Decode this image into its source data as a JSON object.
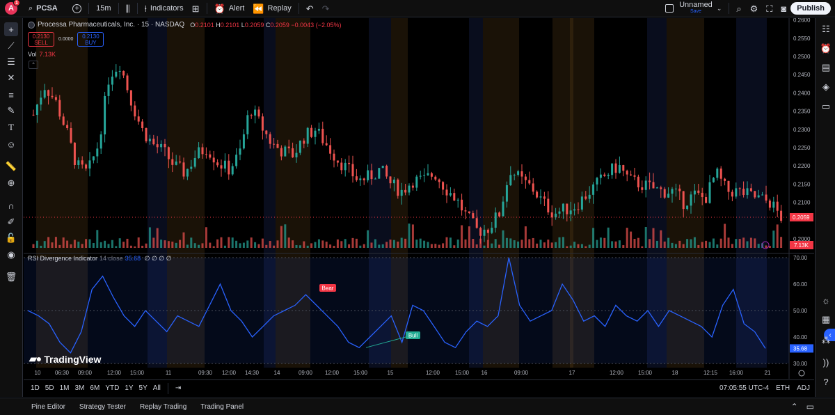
{
  "toolbar": {
    "avatar_letter": "A",
    "notification_count": "1",
    "symbol": "PCSA",
    "interval": "15m",
    "indicators_label": "Indicators",
    "alert_label": "Alert",
    "replay_label": "Replay",
    "layout_name": "Unnamed",
    "layout_save": "Save",
    "publish_label": "Publish"
  },
  "legend": {
    "instrument": "Processa Pharmaceuticals, Inc. · 15 · NASDAQ",
    "open_key": "O",
    "open": "0.2101",
    "high_key": "H",
    "high": "0.2101",
    "low_key": "L",
    "low": "0.2059",
    "close_key": "C",
    "close": "0.2059",
    "change": "−0.0043 (−2.05%)",
    "sell_price": "0.2130",
    "sell_label": "SELL",
    "spread": "0.0000",
    "buy_price": "0.2130",
    "buy_label": "BUY",
    "vol_label": "Vol",
    "vol_value": "7.13K"
  },
  "rsi": {
    "name": "RSI Divergence Indicator",
    "params": "14 close",
    "value": "35.68",
    "placeholders": "∅ ∅ ∅ ∅",
    "bear_label": "Bear",
    "bull_label": "Bull"
  },
  "price_axis": {
    "ticks": [
      "0.2600",
      "0.2550",
      "0.2500",
      "0.2450",
      "0.2400",
      "0.2350",
      "0.2300",
      "0.2250",
      "0.2200",
      "0.2150",
      "0.2100",
      "0.2000"
    ],
    "last_price": "0.2059",
    "vol_tag": "7.13K"
  },
  "rsi_axis": {
    "ticks": [
      "70.00",
      "60.00",
      "50.00",
      "40.00",
      "30.00"
    ],
    "last": "35.68"
  },
  "time_axis": [
    "10",
    "06:30",
    "09:00",
    "12:00",
    "15:00",
    "11",
    "09:30",
    "12:00",
    "14:30",
    "14",
    "09:00",
    "12:00",
    "15:00",
    "15",
    "12:00",
    "15:00",
    "16",
    "09:00",
    "17",
    "12:00",
    "15:00",
    "18",
    "12:15",
    "16:00",
    "21"
  ],
  "range_buttons": [
    "1D",
    "5D",
    "1M",
    "3M",
    "6M",
    "YTD",
    "1Y",
    "5Y",
    "All"
  ],
  "status": {
    "time": "07:05:55 UTC-4",
    "session": "ETH",
    "adj": "ADJ"
  },
  "bottom_tabs": [
    "Pine Editor",
    "Strategy Tester",
    "Replay Trading",
    "Trading Panel"
  ],
  "watermark": "TradingView",
  "colors": {
    "up": "#26a69a",
    "down": "#ef5350",
    "rsi": "#2962ff",
    "bull": "#22ab94",
    "bear": "#f23645"
  },
  "chart_data": {
    "type": "candlestick",
    "symbol": "PCSA",
    "interval": "15",
    "price_range": [
      0.1975,
      0.2605
    ],
    "close_series_approx": [
      0.234,
      0.242,
      0.238,
      0.23,
      0.22,
      0.218,
      0.226,
      0.245,
      0.248,
      0.238,
      0.23,
      0.226,
      0.224,
      0.22,
      0.218,
      0.223,
      0.225,
      0.221,
      0.219,
      0.223,
      0.236,
      0.231,
      0.226,
      0.224,
      0.223,
      0.228,
      0.23,
      0.226,
      0.222,
      0.219,
      0.216,
      0.217,
      0.219,
      0.215,
      0.213,
      0.216,
      0.216,
      0.218,
      0.214,
      0.211,
      0.206,
      0.202,
      0.203,
      0.207,
      0.219,
      0.216,
      0.214,
      0.21,
      0.207,
      0.208,
      0.209,
      0.212,
      0.215,
      0.218,
      0.22,
      0.216,
      0.215,
      0.214,
      0.213,
      0.213,
      0.21,
      0.212,
      0.211,
      0.218,
      0.213,
      0.213,
      0.212,
      0.211,
      0.21,
      0.2059
    ],
    "rsi_range": [
      30,
      70
    ],
    "rsi_series_approx": [
      50,
      48,
      45,
      38,
      34,
      42,
      58,
      63,
      55,
      48,
      44,
      50,
      46,
      42,
      48,
      46,
      44,
      52,
      60,
      50,
      46,
      40,
      44,
      48,
      50,
      52,
      56,
      52,
      48,
      44,
      38,
      36,
      40,
      44,
      48,
      38,
      52,
      50,
      44,
      38,
      36,
      42,
      46,
      44,
      48,
      70,
      52,
      46,
      48,
      50,
      60,
      54,
      46,
      48,
      44,
      52,
      48,
      46,
      50,
      44,
      50,
      48,
      46,
      44,
      40,
      52,
      58,
      45,
      42,
      35.68
    ],
    "divergences": [
      {
        "type": "bear",
        "label": "Bear"
      },
      {
        "type": "bull",
        "label": "Bull"
      }
    ]
  }
}
